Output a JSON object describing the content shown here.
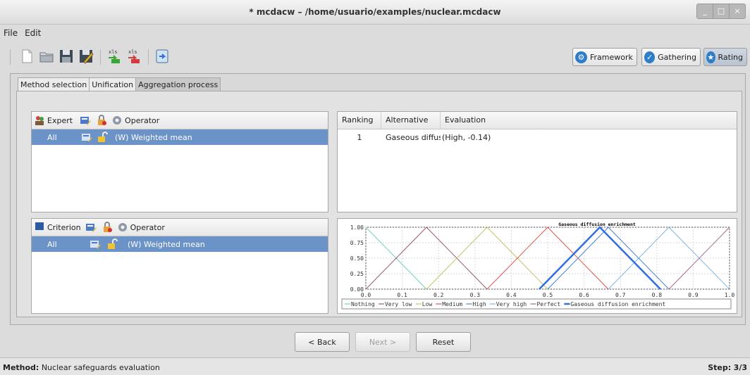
{
  "window": {
    "title": "* mcdacw – /home/usuario/examples/nuclear.mcdacw",
    "controls": [
      "_",
      "□",
      "×"
    ]
  },
  "menu": [
    "File",
    "Edit"
  ],
  "toolbar": {
    "icons": [
      "new-file-icon",
      "open-folder-icon",
      "save-icon",
      "save-as-icon",
      "import-xls-icon",
      "export-xls-icon",
      "export-icon"
    ],
    "xls_label": "xls"
  },
  "phases": [
    {
      "label": "Framework",
      "active": false
    },
    {
      "label": "Gathering",
      "active": false
    },
    {
      "label": "Rating",
      "active": true
    }
  ],
  "tabs": [
    {
      "label": "Method selection",
      "active": false
    },
    {
      "label": "Unification",
      "active": false
    },
    {
      "label": "Aggregation process",
      "active": true
    }
  ],
  "expert_panel": {
    "header": {
      "col1": "Expert",
      "col2": "Operator"
    },
    "row": {
      "name": "All",
      "operator": "(W) Weighted mean"
    }
  },
  "criterion_panel": {
    "header": {
      "col1": "Criterion",
      "col2": "Operator"
    },
    "row": {
      "name": "All",
      "operator": "(W) Weighted mean"
    }
  },
  "ranking_table": {
    "headers": [
      "Ranking",
      "Alternative",
      "Evaluation"
    ],
    "rows": [
      {
        "ranking": "1",
        "alternative": "Gaseous diffus",
        "evaluation": "(High, -0.14)"
      }
    ]
  },
  "chart_data": {
    "type": "line",
    "title": "Gaseous diffusion enrichment",
    "xlim": [
      0,
      1
    ],
    "ylim": [
      0,
      1
    ],
    "xticks": [
      "0.0",
      "0.1",
      "0.2",
      "0.3",
      "0.4",
      "0.5",
      "0.6",
      "0.7",
      "0.8",
      "0.9",
      "1.0"
    ],
    "yticks": [
      "0.00",
      "0.25",
      "0.50",
      "0.75",
      "1.00"
    ],
    "grid": true,
    "legend_position": "bottom",
    "series": [
      {
        "name": "Nothing",
        "color": "#6fd6a8",
        "x": [
          0,
          0,
          0.1667
        ],
        "y": [
          1,
          1,
          0
        ]
      },
      {
        "name": "Very low",
        "color": "#9c5a6e",
        "x": [
          0,
          0.1667,
          0.3333
        ],
        "y": [
          0,
          1,
          0
        ]
      },
      {
        "name": "Low",
        "color": "#c2c26a",
        "x": [
          0.1667,
          0.3333,
          0.5
        ],
        "y": [
          0,
          1,
          0
        ]
      },
      {
        "name": "Medium",
        "color": "#e05550",
        "x": [
          0.3333,
          0.5,
          0.6667
        ],
        "y": [
          0,
          1,
          0
        ]
      },
      {
        "name": "High",
        "color": "#4a84d8",
        "x": [
          0.5,
          0.6667,
          0.8333
        ],
        "y": [
          0,
          1,
          0
        ]
      },
      {
        "name": "Very high",
        "color": "#7eb8e2",
        "x": [
          0.6667,
          0.8333,
          1.0
        ],
        "y": [
          0,
          1,
          0
        ]
      },
      {
        "name": "Perfect",
        "color": "#a66a8c",
        "x": [
          0.8333,
          1.0,
          1.0
        ],
        "y": [
          0,
          1,
          1
        ]
      },
      {
        "name": "Gaseous diffusion enrichment",
        "color": "#2f6fdf",
        "bold": true,
        "x": [
          0.4767,
          0.6433,
          0.81
        ],
        "y": [
          0,
          1,
          0
        ]
      }
    ]
  },
  "buttons": {
    "back": "< Back",
    "next": "Next >",
    "reset": "Reset"
  },
  "status": {
    "method_label": "Method:",
    "method_value": "Nuclear safeguards evaluation",
    "step_label": "Step:",
    "step_value": "3/3"
  }
}
